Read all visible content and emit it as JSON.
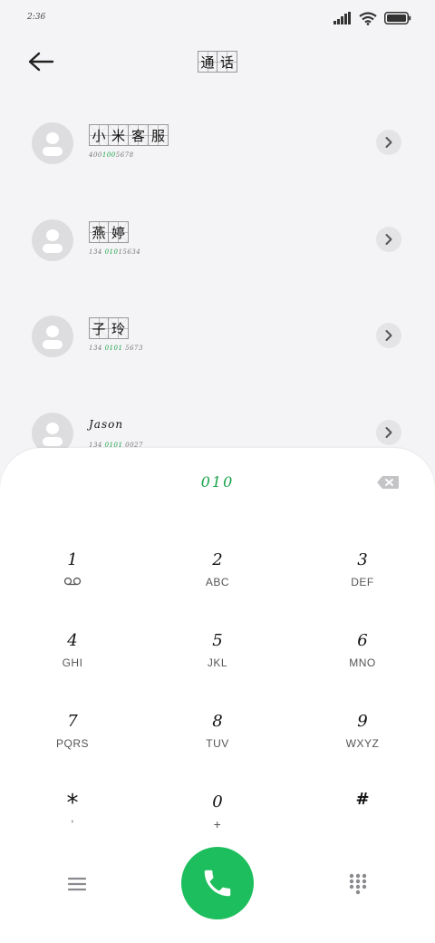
{
  "status_bar": {
    "time": "2:36"
  },
  "header": {
    "title_chars": [
      "通",
      "话"
    ]
  },
  "contacts": [
    {
      "name_chars": [
        "小",
        "米",
        "客",
        "服"
      ],
      "number_parts": [
        "400",
        "100",
        "5678"
      ]
    },
    {
      "name_chars": [
        "燕",
        "婷"
      ],
      "number_parts": [
        "134 ",
        "010",
        "15634"
      ]
    },
    {
      "name_chars": [
        "子",
        "玲"
      ],
      "number_parts": [
        "134 ",
        "0101",
        " 5673"
      ]
    },
    {
      "name": "Jason",
      "number_parts": [
        "134 ",
        "0101",
        " 0027"
      ]
    }
  ],
  "dialpad": {
    "dialed_number": "010",
    "keys": [
      {
        "digit": "1",
        "letters": ""
      },
      {
        "digit": "2",
        "letters": "ABC"
      },
      {
        "digit": "3",
        "letters": "DEF"
      },
      {
        "digit": "4",
        "letters": "GHI"
      },
      {
        "digit": "5",
        "letters": "JKL"
      },
      {
        "digit": "6",
        "letters": "MNO"
      },
      {
        "digit": "7",
        "letters": "PQRS"
      },
      {
        "digit": "8",
        "letters": "TUV"
      },
      {
        "digit": "9",
        "letters": "WXYZ"
      },
      {
        "digit": "*",
        "letters": ","
      },
      {
        "digit": "0",
        "letters": "+"
      },
      {
        "digit": "#",
        "letters": ""
      }
    ]
  },
  "colors": {
    "accent_green": "#1dbe5d",
    "match_green": "#1aa34a"
  },
  "icons": [
    "signal-icon",
    "wifi-icon",
    "battery-icon",
    "back-arrow-icon",
    "avatar-icon",
    "chevron-right-icon",
    "backspace-icon",
    "voicemail-icon",
    "menu-icon",
    "phone-icon",
    "keypad-icon"
  ]
}
